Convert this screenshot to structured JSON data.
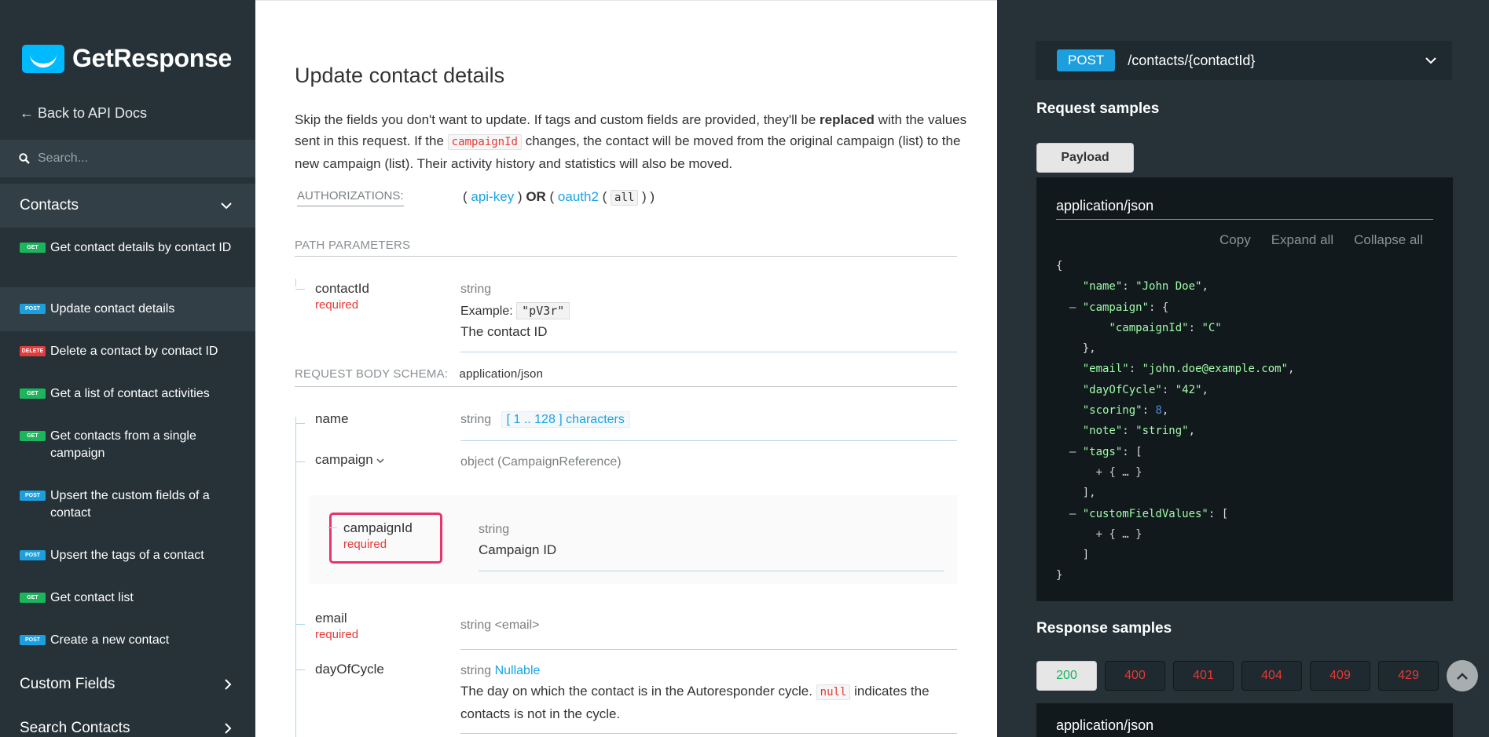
{
  "sidebar": {
    "logo_text": "GetResponse",
    "back_label": "← Back to API Docs",
    "search_placeholder": "Search...",
    "sections": {
      "contacts": "Contacts",
      "custom_fields": "Custom Fields",
      "search_contacts": "Search Contacts"
    },
    "items": [
      {
        "method": "GET",
        "label": "Get contact details by contact ID"
      },
      {
        "method": "POST",
        "label": "Update contact details"
      },
      {
        "method": "DELETE",
        "label": "Delete a contact by contact ID"
      },
      {
        "method": "GET",
        "label": "Get a list of contact activities"
      },
      {
        "method": "GET",
        "label": "Get contacts from a single campaign"
      },
      {
        "method": "POST",
        "label": "Upsert the custom fields of a contact"
      },
      {
        "method": "POST",
        "label": "Upsert the tags of a contact"
      },
      {
        "method": "GET",
        "label": "Get contact list"
      },
      {
        "method": "POST",
        "label": "Create a new contact"
      }
    ]
  },
  "main": {
    "title": "Update contact details",
    "desc": {
      "part1": "Skip the fields you don't want to update. If tags and custom fields are provided, they'll be ",
      "bold": "replaced",
      "part2": " with the values sent in this request. If the ",
      "code": "campaignId",
      "part3": " changes, the contact will be moved from the original campaign (list) to the new campaign (list). Their activity history and statistics will also be moved."
    },
    "auth": {
      "label": "AUTHORIZATIONS:",
      "open1": "( ",
      "api_key": "api-key",
      "close1": " ) ",
      "or": "OR",
      "open2": " ( ",
      "oauth2": "oauth2",
      "paren_open": " ( ",
      "scope": "all",
      "paren_close": " ) )"
    },
    "path_params_label": "PATH PARAMETERS",
    "path_param": {
      "name": "contactId",
      "required": "required",
      "type": "string",
      "example_label": "Example:",
      "example_value": "\"pV3r\"",
      "description": "The contact ID"
    },
    "body_schema_label": "REQUEST BODY SCHEMA:",
    "body_schema_type": "application/json",
    "fields": {
      "name": {
        "name": "name",
        "type": "string",
        "constraint": "[ 1 .. 128 ] characters"
      },
      "campaign": {
        "name": "campaign",
        "type": "object (CampaignReference)"
      },
      "campaignId": {
        "name": "campaignId",
        "required": "required",
        "type": "string",
        "description": "Campaign ID"
      },
      "email": {
        "name": "email",
        "required": "required",
        "type": "string <email>"
      },
      "dayOfCycle": {
        "name": "dayOfCycle",
        "type": "string",
        "nullable": "Nullable",
        "desc_part1": "The day on which the contact is in the Autoresponder cycle. ",
        "code": "null",
        "desc_part2": " indicates the contacts is not in the cycle."
      }
    }
  },
  "panel": {
    "method": "POST",
    "path": "/contacts/{contactId}",
    "request_samples": "Request samples",
    "payload_tab": "Payload",
    "mime": "application/json",
    "tools": {
      "copy": "Copy",
      "expand": "Expand all",
      "collapse": "Collapse all"
    },
    "code": {
      "name_key": "\"name\"",
      "name_val": "\"John Doe\"",
      "campaign_key": "\"campaign\"",
      "campaignId_key": "\"campaignId\"",
      "campaignId_val": "\"C\"",
      "email_key": "\"email\"",
      "email_val": "\"john.doe@example.com\"",
      "day_key": "\"dayOfCycle\"",
      "day_val": "\"42\"",
      "scoring_key": "\"scoring\"",
      "scoring_val": "8",
      "note_key": "\"note\"",
      "note_val": "\"string\"",
      "tags_key": "\"tags\"",
      "cfv_key": "\"customFieldValues\"",
      "collapsed": "+ { … }"
    },
    "response_samples": "Response samples",
    "status_codes": [
      "200",
      "400",
      "401",
      "404",
      "409",
      "429"
    ],
    "response_mime": "application/json"
  }
}
